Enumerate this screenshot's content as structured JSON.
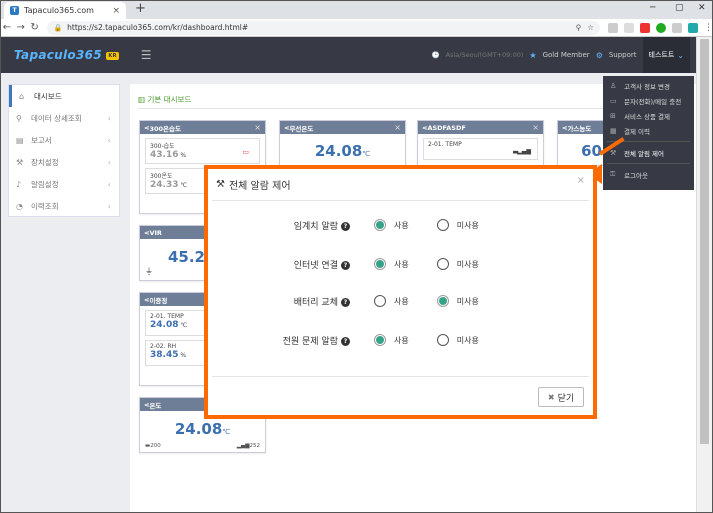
{
  "browser": {
    "tab_title": "Tapaculo365.com",
    "url": "https://s2.tapaculo365.com/kr/dashboard.html#"
  },
  "header": {
    "logo": "Tapaculo365",
    "logo_badge": "KR",
    "timezone": "Asia/Seoul(GMT+09:00)",
    "membership": "Gold Member",
    "support": "Support",
    "user": "테스트트"
  },
  "sidebar": {
    "items": [
      {
        "label": "대시보드",
        "icon": "home-icon"
      },
      {
        "label": "데이터 상세조회",
        "icon": "search-icon"
      },
      {
        "label": "보고서",
        "icon": "document-icon"
      },
      {
        "label": "장치설정",
        "icon": "wrench-icon"
      },
      {
        "label": "알림설정",
        "icon": "bell-icon"
      },
      {
        "label": "이력조회",
        "icon": "history-icon"
      }
    ]
  },
  "breadcrumb": "기본 대시보드",
  "widgets": {
    "w1": {
      "title": "300온습도",
      "s1_name": "300-습도",
      "s1_val": "43.16",
      "s1_unit": "%",
      "s2_name": "300온도",
      "s2_val": "24.33",
      "s2_unit": "℃"
    },
    "w2": {
      "title": "무선온도",
      "val": "24.08",
      "unit": "℃"
    },
    "w3": {
      "title": "ASDFASDF",
      "s1_name": "2-01. TEMP"
    },
    "w4": {
      "title": "가스농도",
      "val": "60"
    },
    "w5": {
      "title": "VIR",
      "val": "45.2"
    },
    "w6": {
      "title": "이중정",
      "s1_name": "2-01. TEMP",
      "s1_val": "24.08",
      "s1_unit": "℃",
      "s2_name": "2-02. RH",
      "s2_val": "38.45",
      "s2_unit": "%"
    },
    "w7": {
      "title": "온도",
      "val": "24.08",
      "unit": "℃",
      "footer_left": "200",
      "footer_right": "252"
    }
  },
  "user_menu": {
    "items": [
      {
        "label": "고객사 정보 변경",
        "icon": "person-icon"
      },
      {
        "label": "문자(전화)/메일 충전",
        "icon": "card-icon"
      },
      {
        "label": "서비스 상품 결제",
        "icon": "cart-icon"
      },
      {
        "label": "결제 이력",
        "icon": "receipt-icon"
      },
      {
        "label": "전체 알림 제어",
        "icon": "wrench-icon"
      },
      {
        "label": "로그아웃",
        "icon": "key-icon"
      }
    ]
  },
  "modal": {
    "title": "전체 알람 제어",
    "option_on": "사용",
    "option_off": "미사용",
    "close_label": "닫기",
    "rows": [
      {
        "label": "임계치 알람",
        "value": "on"
      },
      {
        "label": "인터넷 연결",
        "value": "on"
      },
      {
        "label": "배터리 교체",
        "value": "off"
      },
      {
        "label": "전원 문제 알람",
        "value": "on"
      }
    ]
  },
  "colors": {
    "accent": "#3b6fb0",
    "highlight": "#ff6a00",
    "radio_checked": "#36a388",
    "header_bg": "#373a45"
  }
}
